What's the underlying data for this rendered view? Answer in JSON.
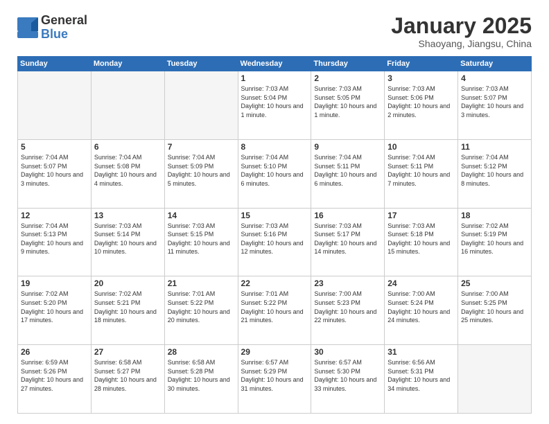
{
  "header": {
    "logo_general": "General",
    "logo_blue": "Blue",
    "month_title": "January 2025",
    "location": "Shaoyang, Jiangsu, China"
  },
  "weekdays": [
    "Sunday",
    "Monday",
    "Tuesday",
    "Wednesday",
    "Thursday",
    "Friday",
    "Saturday"
  ],
  "weeks": [
    [
      {
        "day": "",
        "empty": true
      },
      {
        "day": "",
        "empty": true
      },
      {
        "day": "",
        "empty": true
      },
      {
        "day": "1",
        "sunrise": "7:03 AM",
        "sunset": "5:04 PM",
        "daylight": "10 hours and 1 minute."
      },
      {
        "day": "2",
        "sunrise": "7:03 AM",
        "sunset": "5:05 PM",
        "daylight": "10 hours and 1 minute."
      },
      {
        "day": "3",
        "sunrise": "7:03 AM",
        "sunset": "5:06 PM",
        "daylight": "10 hours and 2 minutes."
      },
      {
        "day": "4",
        "sunrise": "7:03 AM",
        "sunset": "5:07 PM",
        "daylight": "10 hours and 3 minutes."
      }
    ],
    [
      {
        "day": "5",
        "sunrise": "7:04 AM",
        "sunset": "5:07 PM",
        "daylight": "10 hours and 3 minutes."
      },
      {
        "day": "6",
        "sunrise": "7:04 AM",
        "sunset": "5:08 PM",
        "daylight": "10 hours and 4 minutes."
      },
      {
        "day": "7",
        "sunrise": "7:04 AM",
        "sunset": "5:09 PM",
        "daylight": "10 hours and 5 minutes."
      },
      {
        "day": "8",
        "sunrise": "7:04 AM",
        "sunset": "5:10 PM",
        "daylight": "10 hours and 6 minutes."
      },
      {
        "day": "9",
        "sunrise": "7:04 AM",
        "sunset": "5:11 PM",
        "daylight": "10 hours and 6 minutes."
      },
      {
        "day": "10",
        "sunrise": "7:04 AM",
        "sunset": "5:11 PM",
        "daylight": "10 hours and 7 minutes."
      },
      {
        "day": "11",
        "sunrise": "7:04 AM",
        "sunset": "5:12 PM",
        "daylight": "10 hours and 8 minutes."
      }
    ],
    [
      {
        "day": "12",
        "sunrise": "7:04 AM",
        "sunset": "5:13 PM",
        "daylight": "10 hours and 9 minutes."
      },
      {
        "day": "13",
        "sunrise": "7:03 AM",
        "sunset": "5:14 PM",
        "daylight": "10 hours and 10 minutes."
      },
      {
        "day": "14",
        "sunrise": "7:03 AM",
        "sunset": "5:15 PM",
        "daylight": "10 hours and 11 minutes."
      },
      {
        "day": "15",
        "sunrise": "7:03 AM",
        "sunset": "5:16 PM",
        "daylight": "10 hours and 12 minutes."
      },
      {
        "day": "16",
        "sunrise": "7:03 AM",
        "sunset": "5:17 PM",
        "daylight": "10 hours and 14 minutes."
      },
      {
        "day": "17",
        "sunrise": "7:03 AM",
        "sunset": "5:18 PM",
        "daylight": "10 hours and 15 minutes."
      },
      {
        "day": "18",
        "sunrise": "7:02 AM",
        "sunset": "5:19 PM",
        "daylight": "10 hours and 16 minutes."
      }
    ],
    [
      {
        "day": "19",
        "sunrise": "7:02 AM",
        "sunset": "5:20 PM",
        "daylight": "10 hours and 17 minutes."
      },
      {
        "day": "20",
        "sunrise": "7:02 AM",
        "sunset": "5:21 PM",
        "daylight": "10 hours and 18 minutes."
      },
      {
        "day": "21",
        "sunrise": "7:01 AM",
        "sunset": "5:22 PM",
        "daylight": "10 hours and 20 minutes."
      },
      {
        "day": "22",
        "sunrise": "7:01 AM",
        "sunset": "5:22 PM",
        "daylight": "10 hours and 21 minutes."
      },
      {
        "day": "23",
        "sunrise": "7:00 AM",
        "sunset": "5:23 PM",
        "daylight": "10 hours and 22 minutes."
      },
      {
        "day": "24",
        "sunrise": "7:00 AM",
        "sunset": "5:24 PM",
        "daylight": "10 hours and 24 minutes."
      },
      {
        "day": "25",
        "sunrise": "7:00 AM",
        "sunset": "5:25 PM",
        "daylight": "10 hours and 25 minutes."
      }
    ],
    [
      {
        "day": "26",
        "sunrise": "6:59 AM",
        "sunset": "5:26 PM",
        "daylight": "10 hours and 27 minutes."
      },
      {
        "day": "27",
        "sunrise": "6:58 AM",
        "sunset": "5:27 PM",
        "daylight": "10 hours and 28 minutes."
      },
      {
        "day": "28",
        "sunrise": "6:58 AM",
        "sunset": "5:28 PM",
        "daylight": "10 hours and 30 minutes."
      },
      {
        "day": "29",
        "sunrise": "6:57 AM",
        "sunset": "5:29 PM",
        "daylight": "10 hours and 31 minutes."
      },
      {
        "day": "30",
        "sunrise": "6:57 AM",
        "sunset": "5:30 PM",
        "daylight": "10 hours and 33 minutes."
      },
      {
        "day": "31",
        "sunrise": "6:56 AM",
        "sunset": "5:31 PM",
        "daylight": "10 hours and 34 minutes."
      },
      {
        "day": "",
        "empty": true
      }
    ]
  ]
}
